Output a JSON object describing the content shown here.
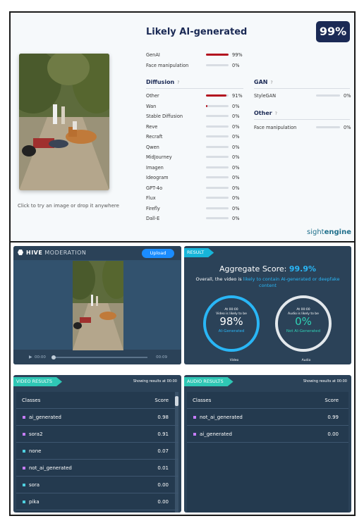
{
  "sightengine": {
    "title": "Likely AI-generated",
    "score_badge": "99%",
    "caption": "Click to try an image or drop it anywhere",
    "top_rows": [
      {
        "label": "GenAI",
        "value": 0.99,
        "pct": "99%"
      },
      {
        "label": "Face manipulation",
        "value": 0.0,
        "pct": "0%"
      }
    ],
    "diffusion": {
      "heading": "Diffusion",
      "help": "?",
      "rows": [
        {
          "label": "Other",
          "value": 0.91,
          "pct": "91%"
        },
        {
          "label": "Wan",
          "value": 0.06,
          "pct": "0%"
        },
        {
          "label": "Stable Diffusion",
          "value": 0,
          "pct": "0%"
        },
        {
          "label": "Reve",
          "value": 0,
          "pct": "0%"
        },
        {
          "label": "Recraft",
          "value": 0,
          "pct": "0%"
        },
        {
          "label": "Qwen",
          "value": 0,
          "pct": "0%"
        },
        {
          "label": "MidJourney",
          "value": 0,
          "pct": "0%"
        },
        {
          "label": "Imagen",
          "value": 0,
          "pct": "0%"
        },
        {
          "label": "Ideogram",
          "value": 0,
          "pct": "0%"
        },
        {
          "label": "GPT-4o",
          "value": 0,
          "pct": "0%"
        },
        {
          "label": "Flux",
          "value": 0,
          "pct": "0%"
        },
        {
          "label": "Firefly",
          "value": 0,
          "pct": "0%"
        },
        {
          "label": "Dall-E",
          "value": 0,
          "pct": "0%"
        }
      ]
    },
    "gan": {
      "heading": "GAN",
      "help": "?",
      "rows": [
        {
          "label": "StyleGAN",
          "value": 0,
          "pct": "0%"
        }
      ]
    },
    "other": {
      "heading": "Other",
      "help": "?",
      "rows": [
        {
          "label": "Face manipulation",
          "value": 0,
          "pct": "0%"
        }
      ]
    },
    "logo_a": "sight",
    "logo_b": "engine",
    "bar_color": "#b3121f"
  },
  "hive": {
    "logo_bold": "HIVE",
    "logo_rest": " MODERATION",
    "upload_label": "Upload",
    "time_start": "00:00",
    "time_end": "00:09",
    "play_icon": "play-icon",
    "result_label": "RESULT",
    "agg_label": "Aggregate Score:",
    "agg_value": "99.9%",
    "agg_sub_pre": "Overall, the video is ",
    "agg_sub_hl": "likely to contain AI-generated or deepfake content",
    "video_gauge": {
      "small1": "At 00:00",
      "small2": "Video is likely to be",
      "big": "98%",
      "label": "AI-Generated",
      "caption": "Video",
      "color": "#29b6f6"
    },
    "audio_gauge": {
      "small1": "At 00:00",
      "small2": "Audio is likely to be",
      "big": "0%",
      "label": "Not AI-Generated",
      "caption": "Audio",
      "color": "#2fd3b7"
    },
    "video_results": {
      "title": "VIDEO RESULTS",
      "showing": "Showing results at 00:00",
      "col_classes": "Classes",
      "col_score": "Score",
      "rows": [
        {
          "cls": "ai_generated",
          "score": "0.98",
          "color": "#c77dff"
        },
        {
          "cls": "sora2",
          "score": "0.91",
          "color": "#c77dff"
        },
        {
          "cls": "none",
          "score": "0.07",
          "color": "#4fd1e0"
        },
        {
          "cls": "not_ai_generated",
          "score": "0.01",
          "color": "#c77dff"
        },
        {
          "cls": "sora",
          "score": "0.00",
          "color": "#4fd1e0"
        },
        {
          "cls": "pika",
          "score": "0.00",
          "color": "#4fd1e0"
        }
      ]
    },
    "audio_results": {
      "title": "AUDIO RESULTS",
      "showing": "Showing results at 00:00",
      "col_classes": "Classes",
      "col_score": "Score",
      "rows": [
        {
          "cls": "not_ai_generated",
          "score": "0.99",
          "color": "#c77dff"
        },
        {
          "cls": "ai_generated",
          "score": "0.00",
          "color": "#c77dff"
        }
      ]
    }
  }
}
